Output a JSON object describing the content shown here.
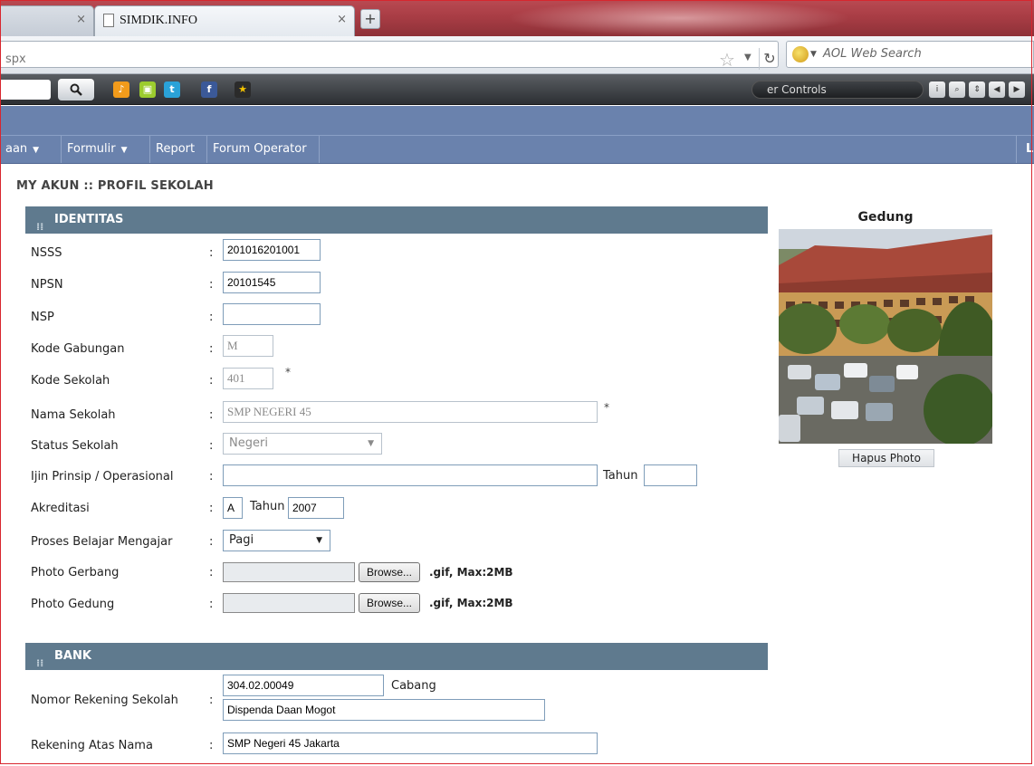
{
  "browser": {
    "tab_inactive_close": "×",
    "tab_active_title": "SIMDIK.INFO",
    "tab_active_close": "×",
    "new_tab": "+",
    "url_fragment": "spx",
    "search_placeholder": "AOL Web Search",
    "toolbar_controls_label": "er Controls"
  },
  "nav": {
    "items": [
      {
        "label": "aan",
        "caret": "▼"
      },
      {
        "label": "Formulir",
        "caret": "▼"
      },
      {
        "label": "Report",
        "caret": ""
      },
      {
        "label": "Forum Operator",
        "caret": ""
      }
    ],
    "right_label": "L"
  },
  "page_title": "MY AKUN :: PROFIL SEKOLAH",
  "identitas": {
    "header": "IDENTITAS",
    "nsss_label": "NSSS",
    "nsss_value": "201016201001",
    "npsn_label": "NPSN",
    "npsn_value": "20101545",
    "nsp_label": "NSP",
    "nsp_value": "",
    "kode_gabungan_label": "Kode Gabungan",
    "kode_gabungan_value": "M",
    "kode_sekolah_label": "Kode Sekolah",
    "kode_sekolah_value": "401",
    "nama_sekolah_label": "Nama Sekolah",
    "nama_sekolah_value": "SMP NEGERI 45",
    "status_sekolah_label": "Status Sekolah",
    "status_sekolah_value": "Negeri",
    "ijin_label": "Ijin Prinsip / Operasional",
    "ijin_value": "",
    "ijin_tahun_label": "Tahun",
    "ijin_tahun_value": "",
    "akreditasi_label": "Akreditasi",
    "akreditasi_value": "A",
    "akreditasi_tahun_label": "Tahun",
    "akreditasi_tahun_value": "2007",
    "pbm_label": "Proses Belajar Mengajar",
    "pbm_value": "Pagi",
    "photo_gerbang_label": "Photo Gerbang",
    "photo_gedung_label": "Photo Gedung",
    "browse_label": "Browse...",
    "file_hint": ".gif, Max:2MB",
    "required_mark": "*",
    "colon": ":"
  },
  "bank": {
    "header": "BANK",
    "rekening_label": "Nomor Rekening Sekolah",
    "rekening_value": "304.02.00049",
    "cabang_label": "Cabang",
    "cabang_value": "Dispenda Daan Mogot",
    "atas_nama_label": "Rekening Atas Nama",
    "atas_nama_value": "SMP Negeri 45 Jakarta"
  },
  "photo_panel": {
    "title": "Gedung",
    "delete_label": "Hapus Photo"
  },
  "colors": {
    "menu_bg": "#6a82ad",
    "section_header_bg": "#5f7a8e",
    "tabstrip_bg": "#a93d45"
  }
}
